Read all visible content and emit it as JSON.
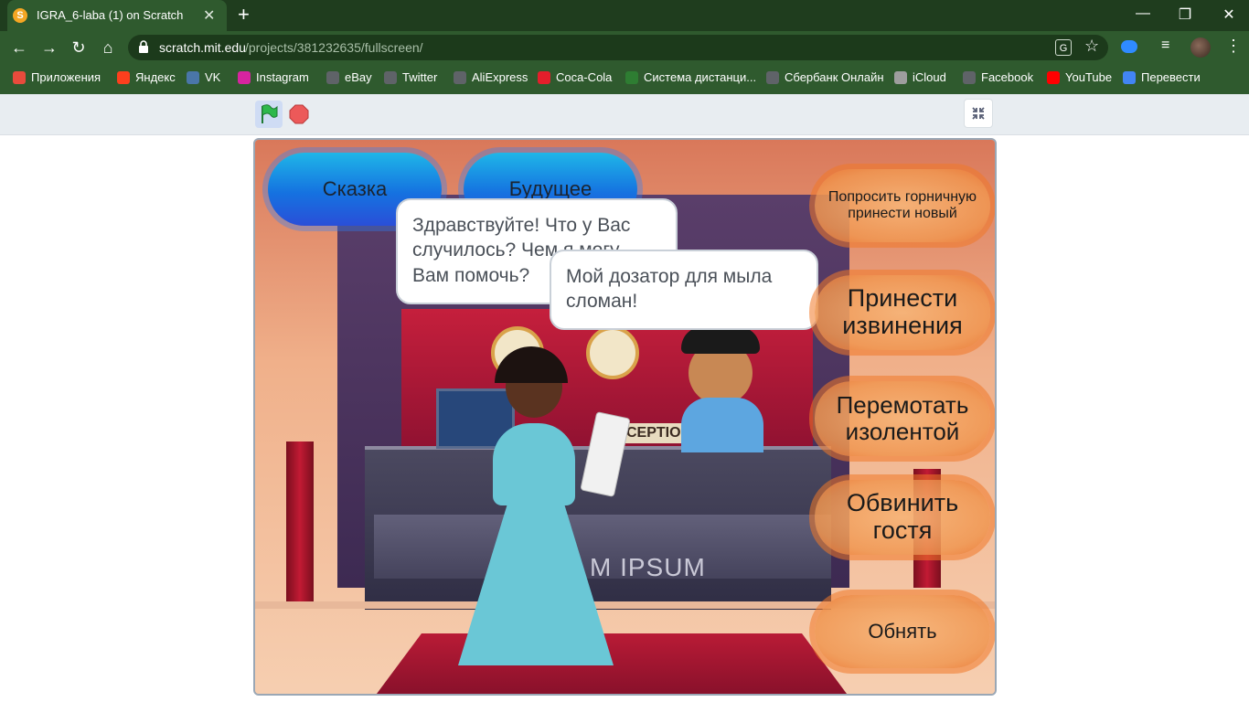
{
  "browser": {
    "tab_title": "IGRA_6-laba (1) on Scratch",
    "tab_close": "✕",
    "new_tab": "+",
    "window_controls": [
      "—",
      "❐",
      "✕"
    ],
    "nav": {
      "back": "←",
      "forward": "→",
      "reload": "↻",
      "home": "⌂"
    },
    "url_host": "scratch.mit.edu",
    "url_path": "/projects/381232635/fullscreen/",
    "bookmarks": [
      {
        "label": "Приложения",
        "icon": "apps-grid-icon",
        "color": "#e84b3c"
      },
      {
        "label": "Яндекс",
        "icon": "yandex-icon",
        "color": "#fc3f1d"
      },
      {
        "label": "VK",
        "icon": "vk-icon",
        "color": "#4a76a8"
      },
      {
        "label": "Instagram",
        "icon": "instagram-icon",
        "color": "#d6249f"
      },
      {
        "label": "eBay",
        "icon": "globe-icon",
        "color": "#5f6368"
      },
      {
        "label": "Twitter",
        "icon": "globe-icon",
        "color": "#5f6368"
      },
      {
        "label": "AliExpress",
        "icon": "globe-icon",
        "color": "#5f6368"
      },
      {
        "label": "Coca-Cola",
        "icon": "coca-cola-icon",
        "color": "#e41e2b"
      },
      {
        "label": "Система дистанци...",
        "icon": "moodle-icon",
        "color": "#2e7d32"
      },
      {
        "label": "Сбербанк Онлайн",
        "icon": "globe-icon",
        "color": "#5f6368"
      },
      {
        "label": "iCloud",
        "icon": "apple-icon",
        "color": "#9e9e9e"
      },
      {
        "label": "Facebook",
        "icon": "globe-icon",
        "color": "#5f6368"
      },
      {
        "label": "YouTube",
        "icon": "youtube-icon",
        "color": "#ff0000"
      },
      {
        "label": "Перевести",
        "icon": "google-translate-icon",
        "color": "#4285f4"
      }
    ]
  },
  "scratch": {
    "top_buttons": [
      "Сказка",
      "Будущее"
    ],
    "dialog_receptionist": "Здравствуйте! Что у Вас случилось? Чем я могу Вам помочь?",
    "dialog_guest": "Мой дозатор для мыла сломан!",
    "choices": [
      "Попросить горничную принести новый",
      "Принести извинения",
      "Перемотать изолентой",
      "Обвинить гостя",
      "Обнять"
    ],
    "sign_reception": "CEPTION",
    "sign_desk": "M IPSUM"
  },
  "colors": {
    "chrome_dark": "#1f3d1e",
    "chrome": "#2f5a2e",
    "flag": "#2db84c",
    "stop": "#ec5959"
  }
}
